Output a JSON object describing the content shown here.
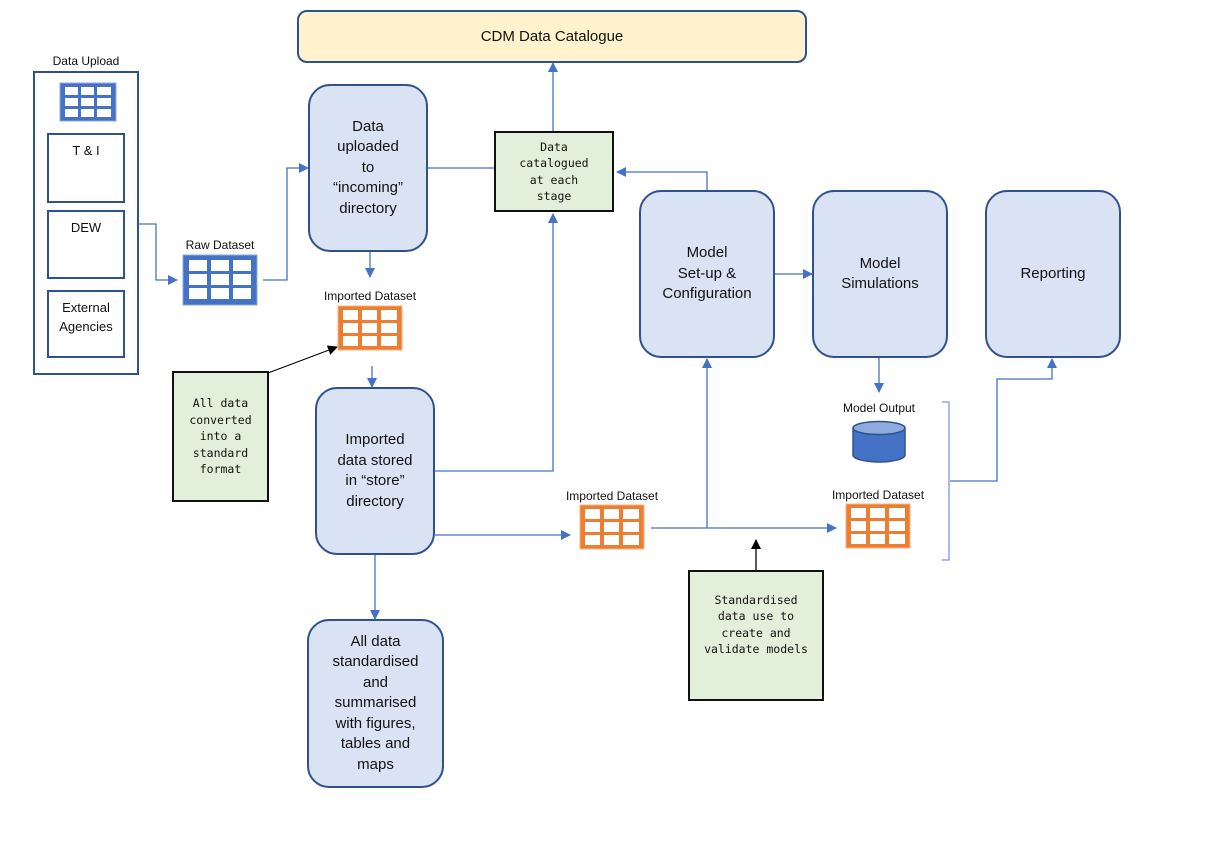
{
  "catalogue": {
    "title": "CDM Data Catalogue"
  },
  "upload": {
    "title": "Data Upload",
    "sources": [
      "T & I",
      "DEW",
      "External\nAgencies"
    ]
  },
  "datasets": {
    "raw": "Raw Dataset",
    "imported_1": "Imported Dataset",
    "imported_2": "Imported Dataset",
    "imported_3": "Imported Dataset",
    "model_output": "Model Output"
  },
  "nodes": {
    "incoming": "Data\nuploaded\nto\n“incoming”\ndirectory",
    "store": "Imported\ndata stored\nin “store”\ndirectory",
    "summarised": "All data\nstandardised\nand\nsummarised\nwith figures,\ntables and\nmaps",
    "setup": "Model\nSet-up &\nConfiguration",
    "simulations": "Model\nSimulations",
    "reporting": "Reporting"
  },
  "notes": {
    "catalogued": "Data\ncatalogued\nat each\nstage",
    "converted": "All data\nconverted\ninto a\nstandard\nformat",
    "standardised": "Standardised\ndata use to\ncreate and\nvalidate models"
  },
  "colors": {
    "node_fill": "#dae3f3",
    "node_border": "#2f528f",
    "connector": "#4472c4",
    "raw_dataset": "#4472c4",
    "imported_dataset": "#ed7d31",
    "note_fill": "#e2efda",
    "catalogue_fill": "#fff2cc"
  }
}
